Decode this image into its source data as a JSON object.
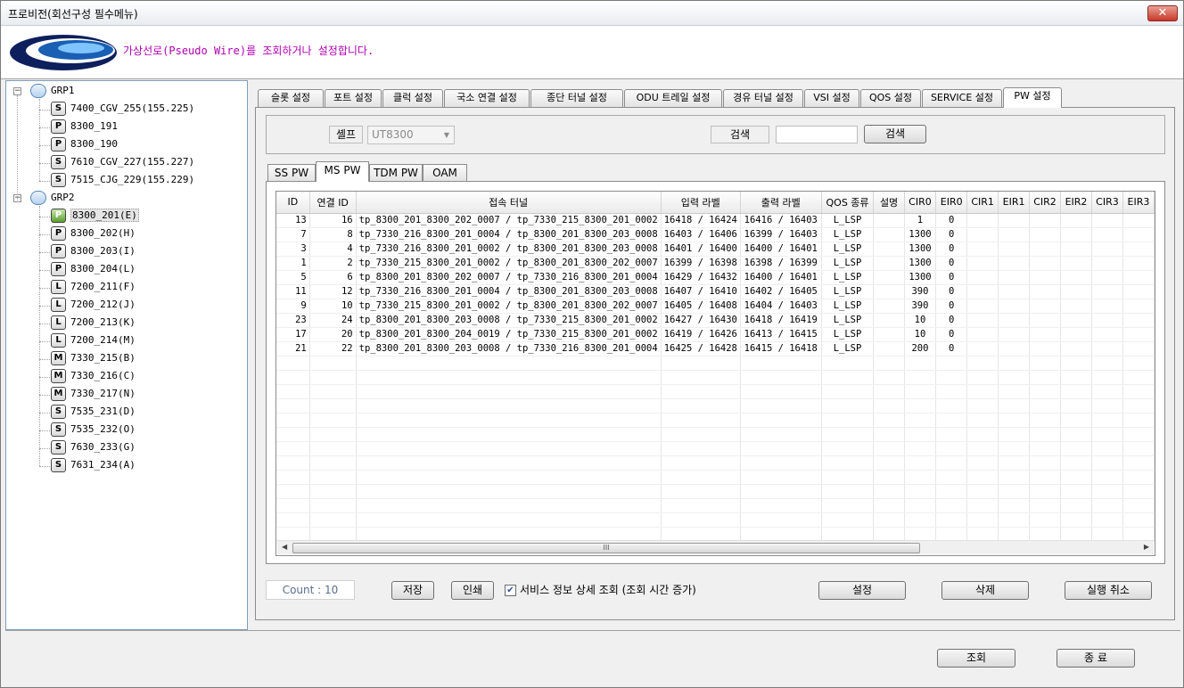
{
  "window": {
    "title": "프로비전(회선구성 필수메뉴)",
    "close_label": "✕"
  },
  "header": {
    "message": "가상선로(Pseudo Wire)를 조회하거나 설정합니다."
  },
  "tree": {
    "groups": [
      {
        "label": "GRP1",
        "nodes": [
          {
            "icon": "S",
            "label": "7400_CGV_255(155.225)"
          },
          {
            "icon": "P",
            "label": "8300_191"
          },
          {
            "icon": "P",
            "label": "8300_190"
          },
          {
            "icon": "S",
            "label": "7610_CGV_227(155.227)"
          },
          {
            "icon": "S",
            "label": "7515_CJG_229(155.229)"
          }
        ]
      },
      {
        "label": "GRP2",
        "nodes": [
          {
            "icon": "P",
            "label": "8300_201(E)"
          },
          {
            "icon": "P",
            "label": "8300_202(H)"
          },
          {
            "icon": "P",
            "label": "8300_203(I)"
          },
          {
            "icon": "P",
            "label": "8300_204(L)"
          },
          {
            "icon": "L",
            "label": "7200_211(F)"
          },
          {
            "icon": "L",
            "label": "7200_212(J)"
          },
          {
            "icon": "L",
            "label": "7200_213(K)"
          },
          {
            "icon": "L",
            "label": "7200_214(M)"
          },
          {
            "icon": "M",
            "label": "7330_215(B)"
          },
          {
            "icon": "M",
            "label": "7330_216(C)"
          },
          {
            "icon": "M",
            "label": "7330_217(N)"
          },
          {
            "icon": "S",
            "label": "7535_231(D)"
          },
          {
            "icon": "S",
            "label": "7535_232(O)"
          },
          {
            "icon": "S",
            "label": "7630_233(G)"
          },
          {
            "icon": "S",
            "label": "7631_234(A)"
          }
        ]
      }
    ],
    "selected": "8300_201(E)"
  },
  "tabs": [
    "슬롯 설정",
    "포트 설정",
    "클럭 설정",
    "국소 연결 설정",
    "종단 터널 설정",
    "ODU 트레일 설정",
    "경유 터널 설정",
    "VSI 설정",
    "QOS 설정",
    "SERVICE 설정",
    "PW 설정"
  ],
  "active_tab": "PW 설정",
  "search": {
    "shelf_label": "셸프",
    "shelf_value": "UT8300",
    "search_label": "검색",
    "search_value": "",
    "search_button": "검색"
  },
  "subtabs": [
    "SS PW",
    "MS PW",
    "TDM PW",
    "OAM"
  ],
  "active_subtab": "MS PW",
  "table": {
    "columns": [
      "ID",
      "연결 ID",
      "접속 터널",
      "입력 라벨",
      "출력 라벨",
      "QOS 종류",
      "설명",
      "CIR0",
      "EIR0",
      "CIR1",
      "EIR1",
      "CIR2",
      "EIR2",
      "CIR3",
      "EIR3"
    ],
    "rows": [
      [
        "13",
        "16",
        "tp_8300_201_8300_202_0007 / tp_7330_215_8300_201_0002",
        "16418 / 16424",
        "16416 / 16403",
        "L_LSP",
        "",
        "1",
        "0",
        "",
        "",
        "",
        "",
        "",
        ""
      ],
      [
        "7",
        "8",
        "tp_7330_216_8300_201_0004 / tp_8300_201_8300_203_0008",
        "16403 / 16406",
        "16399 / 16403",
        "L_LSP",
        "",
        "1300",
        "0",
        "",
        "",
        "",
        "",
        "",
        ""
      ],
      [
        "3",
        "4",
        "tp_7330_216_8300_201_0002 / tp_8300_201_8300_203_0008",
        "16401 / 16400",
        "16400 / 16401",
        "L_LSP",
        "",
        "1300",
        "0",
        "",
        "",
        "",
        "",
        "",
        ""
      ],
      [
        "1",
        "2",
        "tp_7330_215_8300_201_0002 / tp_8300_201_8300_202_0007",
        "16399 / 16398",
        "16398 / 16399",
        "L_LSP",
        "",
        "1300",
        "0",
        "",
        "",
        "",
        "",
        "",
        ""
      ],
      [
        "5",
        "6",
        "tp_8300_201_8300_202_0007 / tp_7330_216_8300_201_0004",
        "16429 / 16432",
        "16400 / 16401",
        "L_LSP",
        "",
        "1300",
        "0",
        "",
        "",
        "",
        "",
        "",
        ""
      ],
      [
        "11",
        "12",
        "tp_7330_216_8300_201_0004 / tp_8300_201_8300_203_0008",
        "16407 / 16410",
        "16402 / 16405",
        "L_LSP",
        "",
        "390",
        "0",
        "",
        "",
        "",
        "",
        "",
        ""
      ],
      [
        "9",
        "10",
        "tp_7330_215_8300_201_0002 / tp_8300_201_8300_202_0007",
        "16405 / 16408",
        "16404 / 16403",
        "L_LSP",
        "",
        "390",
        "0",
        "",
        "",
        "",
        "",
        "",
        ""
      ],
      [
        "23",
        "24",
        "tp_8300_201_8300_203_0008 / tp_7330_215_8300_201_0002",
        "16427 / 16430",
        "16418 / 16419",
        "L_LSP",
        "",
        "10",
        "0",
        "",
        "",
        "",
        "",
        "",
        ""
      ],
      [
        "17",
        "20",
        "tp_8300_201_8300_204_0019 / tp_7330_215_8300_201_0002",
        "16419 / 16426",
        "16413 / 16415",
        "L_LSP",
        "",
        "10",
        "0",
        "",
        "",
        "",
        "",
        "",
        ""
      ],
      [
        "21",
        "22",
        "tp_8300_201_8300_203_0008 / tp_7330_216_8300_201_0004",
        "16425 / 16428",
        "16415 / 16418",
        "L_LSP",
        "",
        "200",
        "0",
        "",
        "",
        "",
        "",
        "",
        ""
      ]
    ],
    "scroll_thumb": "III"
  },
  "footer": {
    "count": "Count : 10",
    "save": "저장",
    "print": "인쇄",
    "detail_checkbox_checked": true,
    "detail_checkbox_label": "서비스 정보 상세 조회 (조회 시간 증가)",
    "set": "설정",
    "delete": "삭제",
    "undo": "실행 취소"
  },
  "bottom": {
    "query": "조회",
    "exit": "종 료"
  },
  "colors": {
    "header_message": "#b000b0",
    "count_text": "#5b6d8c"
  }
}
